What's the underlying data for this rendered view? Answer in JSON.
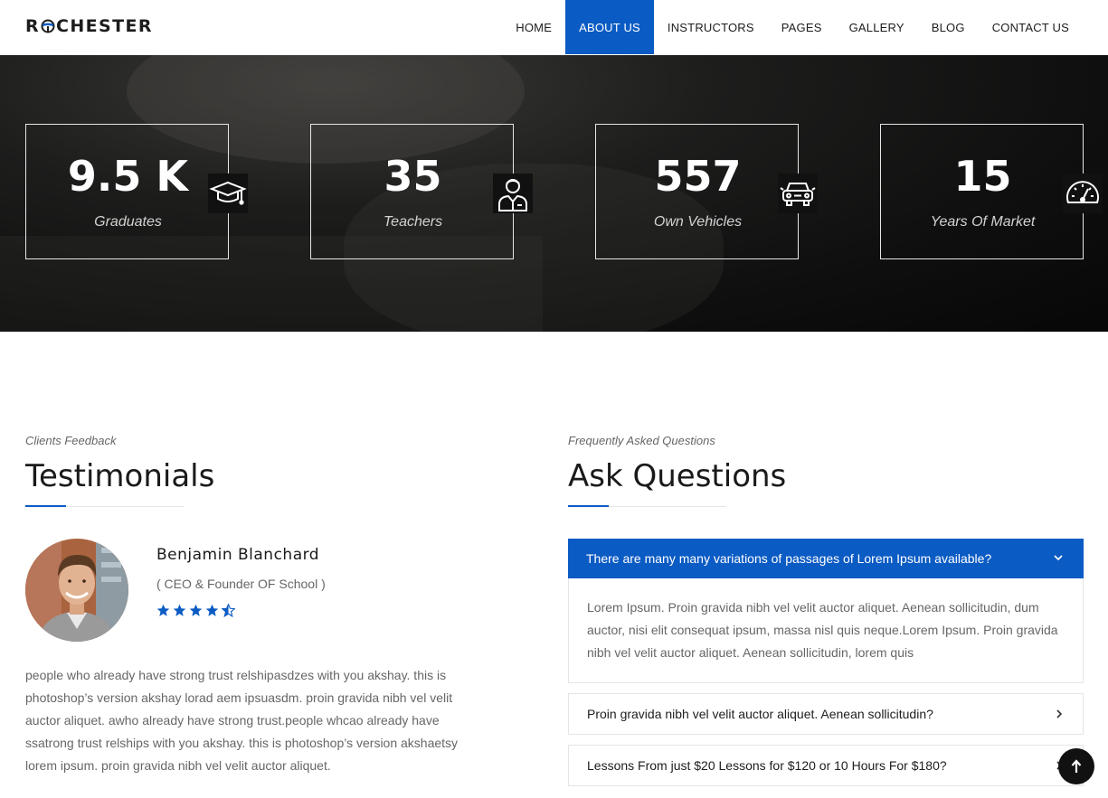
{
  "logo": {
    "before": "R",
    "after": "CHESTER"
  },
  "nav": {
    "items": [
      "HOME",
      "ABOUT US",
      "INSTRUCTORS",
      "PAGES",
      "GALLERY",
      "BLOG",
      "CONTACT US"
    ],
    "active": "ABOUT US"
  },
  "stats": [
    {
      "value": "9.5 K",
      "label": "Graduates",
      "icon": "graduation-cap-icon"
    },
    {
      "value": "35",
      "label": "Teachers",
      "icon": "teacher-icon"
    },
    {
      "value": "557",
      "label": "Own Vehicles",
      "icon": "car-icon"
    },
    {
      "value": "15",
      "label": "Years Of Market",
      "icon": "speedometer-icon"
    }
  ],
  "testimonials": {
    "subtitle": "Clients Feedback",
    "title": "Testimonials",
    "name": "Benjamin Blanchard",
    "role": "( CEO & Founder OF School )",
    "rating": 4.5,
    "quote": "people who already have strong trust relshipasdzes with you akshay. this is photoshop’s version akshay lorad aem ipsuasdm. proin gravida nibh vel velit auctor aliquet. awho already have strong trust.people whcao already have ssatrong trust relships with you akshay. this is photoshop’s version akshaetsy lorem ipsum. proin gravida nibh vel velit auctor aliquet."
  },
  "faq": {
    "subtitle": "Frequently Asked Questions",
    "title": "Ask Questions",
    "open": {
      "question": "There are many many variations of passages of Lorem Ipsum available?",
      "answer": "Lorem Ipsum. Proin gravida nibh vel velit auctor aliquet. Aenean sollicitudin, dum auctor, nisi elit consequat ipsum, massa nisl quis neque.Lorem Ipsum. Proin gravida nibh vel velit auctor aliquet. Aenean sollicitudin, lorem quis"
    },
    "items": [
      "Proin gravida nibh vel velit auctor aliquet. Aenean sollicitudin?",
      "Lessons From just $20 Lessons for $120 or 10 Hours For $180?"
    ]
  },
  "colors": {
    "accent": "#0b5bc4",
    "dark": "#111111",
    "text": "#666666"
  }
}
